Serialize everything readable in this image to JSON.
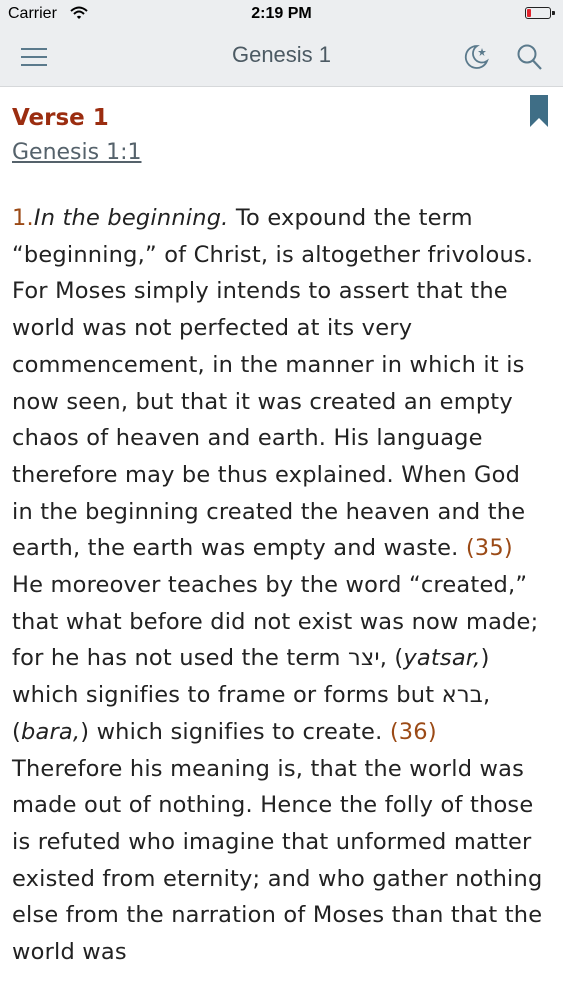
{
  "status_bar": {
    "carrier": "Carrier",
    "time": "2:19 PM",
    "battery_level": 0.1,
    "battery_color": "#e0242d"
  },
  "nav": {
    "title": "Genesis 1",
    "icons": [
      "menu-icon",
      "night-mode-icon",
      "search-icon"
    ]
  },
  "verse": {
    "heading": "Verse 1",
    "reference": "Genesis 1:1",
    "bookmark_color": "#3f6e86"
  },
  "commentary": {
    "number": "1.",
    "lead_italic": "In the beginning.",
    "p1": " To expound the term “beginning,” of Christ, is altogether frivolous. For Moses simply intends to assert that the world was not perfected at its very commencement, in the manner in which it is now seen, but that it was created an empty chaos of heaven and earth. His language therefore may be thus explained. When God in the beginning created the heaven and the earth, the earth was empty and waste. ",
    "fn1": "(35)",
    "p2": " He moreover teaches by the word “created,” that what before did not exist was now made; for he has not used the term ",
    "hebrew1": "יצר",
    "p3": ", (",
    "translit1": "yatsar,",
    "p4": ") which signifies to frame or forms but ",
    "hebrew2": "ברא",
    "p5": ", (",
    "translit2": "bara,",
    "p6": ") which signifies to create. ",
    "fn2": "(36)",
    "p7": " Therefore his meaning is, that the world was made out of nothing. Hence the folly of those is refuted who imagine that unformed matter existed from eternity; and who gather nothing else from the narration of Moses than that the world was"
  },
  "colors": {
    "accent": "#9b2d10",
    "footnote": "#9b4a16",
    "nav_bg": "#eceef0",
    "nav_icon": "#5b7a8c"
  }
}
